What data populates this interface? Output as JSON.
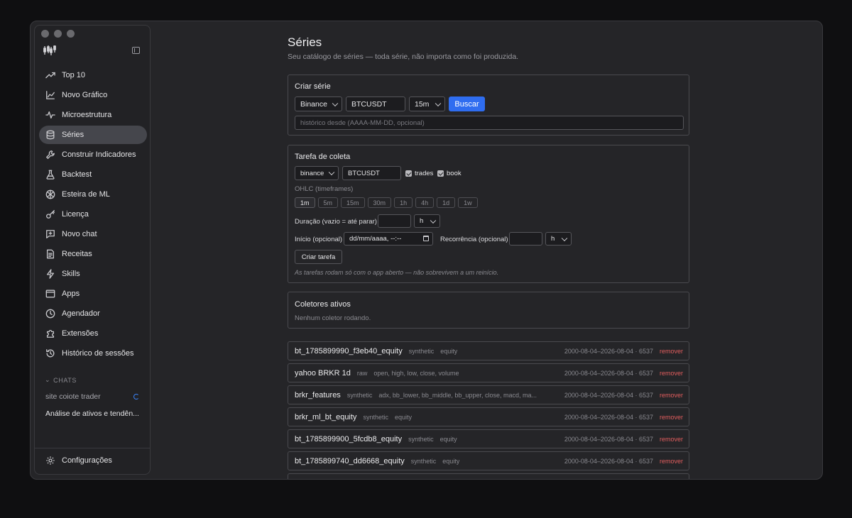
{
  "sidebar": {
    "items": [
      {
        "label": "Top 10",
        "icon": "trending-up-icon"
      },
      {
        "label": "Novo Gráfico",
        "icon": "chart-icon"
      },
      {
        "label": "Microestrutura",
        "icon": "activity-icon"
      },
      {
        "label": "Séries",
        "icon": "database-icon"
      },
      {
        "label": "Construir Indicadores",
        "icon": "wrench-icon"
      },
      {
        "label": "Backtest",
        "icon": "flask-icon"
      },
      {
        "label": "Esteira de ML",
        "icon": "brain-icon"
      },
      {
        "label": "Licença",
        "icon": "key-icon"
      },
      {
        "label": "Novo chat",
        "icon": "new-chat-icon"
      },
      {
        "label": "Receitas",
        "icon": "document-icon"
      },
      {
        "label": "Skills",
        "icon": "lightning-icon"
      },
      {
        "label": "Apps",
        "icon": "app-window-icon"
      },
      {
        "label": "Agendador",
        "icon": "clock-icon"
      },
      {
        "label": "Extensões",
        "icon": "puzzle-icon"
      },
      {
        "label": "Histórico de sessões",
        "icon": "history-icon"
      }
    ],
    "active_item": "Séries",
    "chats_header": "CHATS",
    "chats": [
      "site coiote trader",
      "Análise de ativos e tendên..."
    ],
    "settings_label": "Configurações"
  },
  "page": {
    "title": "Séries",
    "subtitle": "Seu catálogo de séries — toda série, não importa como foi produzida."
  },
  "create_series": {
    "title": "Criar série",
    "exchange": "Binance",
    "symbol": "BTCUSDT",
    "timeframe": "15m",
    "search_label": "Buscar",
    "history_placeholder": "histórico desde (AAAA-MM-DD, opcional)"
  },
  "collect_task": {
    "title": "Tarefa de coleta",
    "exchange": "binance",
    "symbol": "BTCUSDT",
    "trades_label": "trades",
    "book_label": "book",
    "ohlc_label": "OHLC (timeframes)",
    "timeframes": [
      "1m",
      "5m",
      "15m",
      "30m",
      "1h",
      "4h",
      "1d",
      "1w"
    ],
    "selected_timeframe": "1m",
    "duration_label": "Duração (vazio = até parar)",
    "duration_unit": "h",
    "start_label": "Início (opcional)",
    "start_placeholder": "dd/mm/aaaa, --:--",
    "recurrence_label": "Recorrência (opcional)",
    "recurrence_unit": "h",
    "create_label": "Criar tarefa",
    "note": "As tarefas rodam só com o app aberto — não sobrevivem a um reinício."
  },
  "active_collectors": {
    "title": "Coletores ativos",
    "empty": "Nenhum coletor rodando."
  },
  "series": [
    {
      "name": "bt_1785899990_f3eb40_equity",
      "kind": "synthetic",
      "cols": "equity",
      "range": "2000-08-04–2026-08-04 · 6537",
      "action": "remover"
    },
    {
      "name": "yahoo BRKR 1d",
      "kind": "raw",
      "cols": "open, high, low, close, volume",
      "range": "2000-08-04–2026-08-04 · 6537",
      "action": "remover"
    },
    {
      "name": "brkr_features",
      "kind": "synthetic",
      "cols": "adx, bb_lower, bb_middle, bb_upper, close, macd, ma...",
      "range": "2000-08-04–2026-08-04 · 6537",
      "action": "remover"
    },
    {
      "name": "brkr_ml_bt_equity",
      "kind": "synthetic",
      "cols": "equity",
      "range": "2000-08-04–2026-08-04 · 6537",
      "action": "remover"
    },
    {
      "name": "bt_1785899900_5fcdb8_equity",
      "kind": "synthetic",
      "cols": "equity",
      "range": "2000-08-04–2026-08-04 · 6537",
      "action": "remover"
    },
    {
      "name": "bt_1785899740_dd6668_equity",
      "kind": "synthetic",
      "cols": "equity",
      "range": "2000-08-04–2026-08-04 · 6537",
      "action": "remover"
    }
  ]
}
